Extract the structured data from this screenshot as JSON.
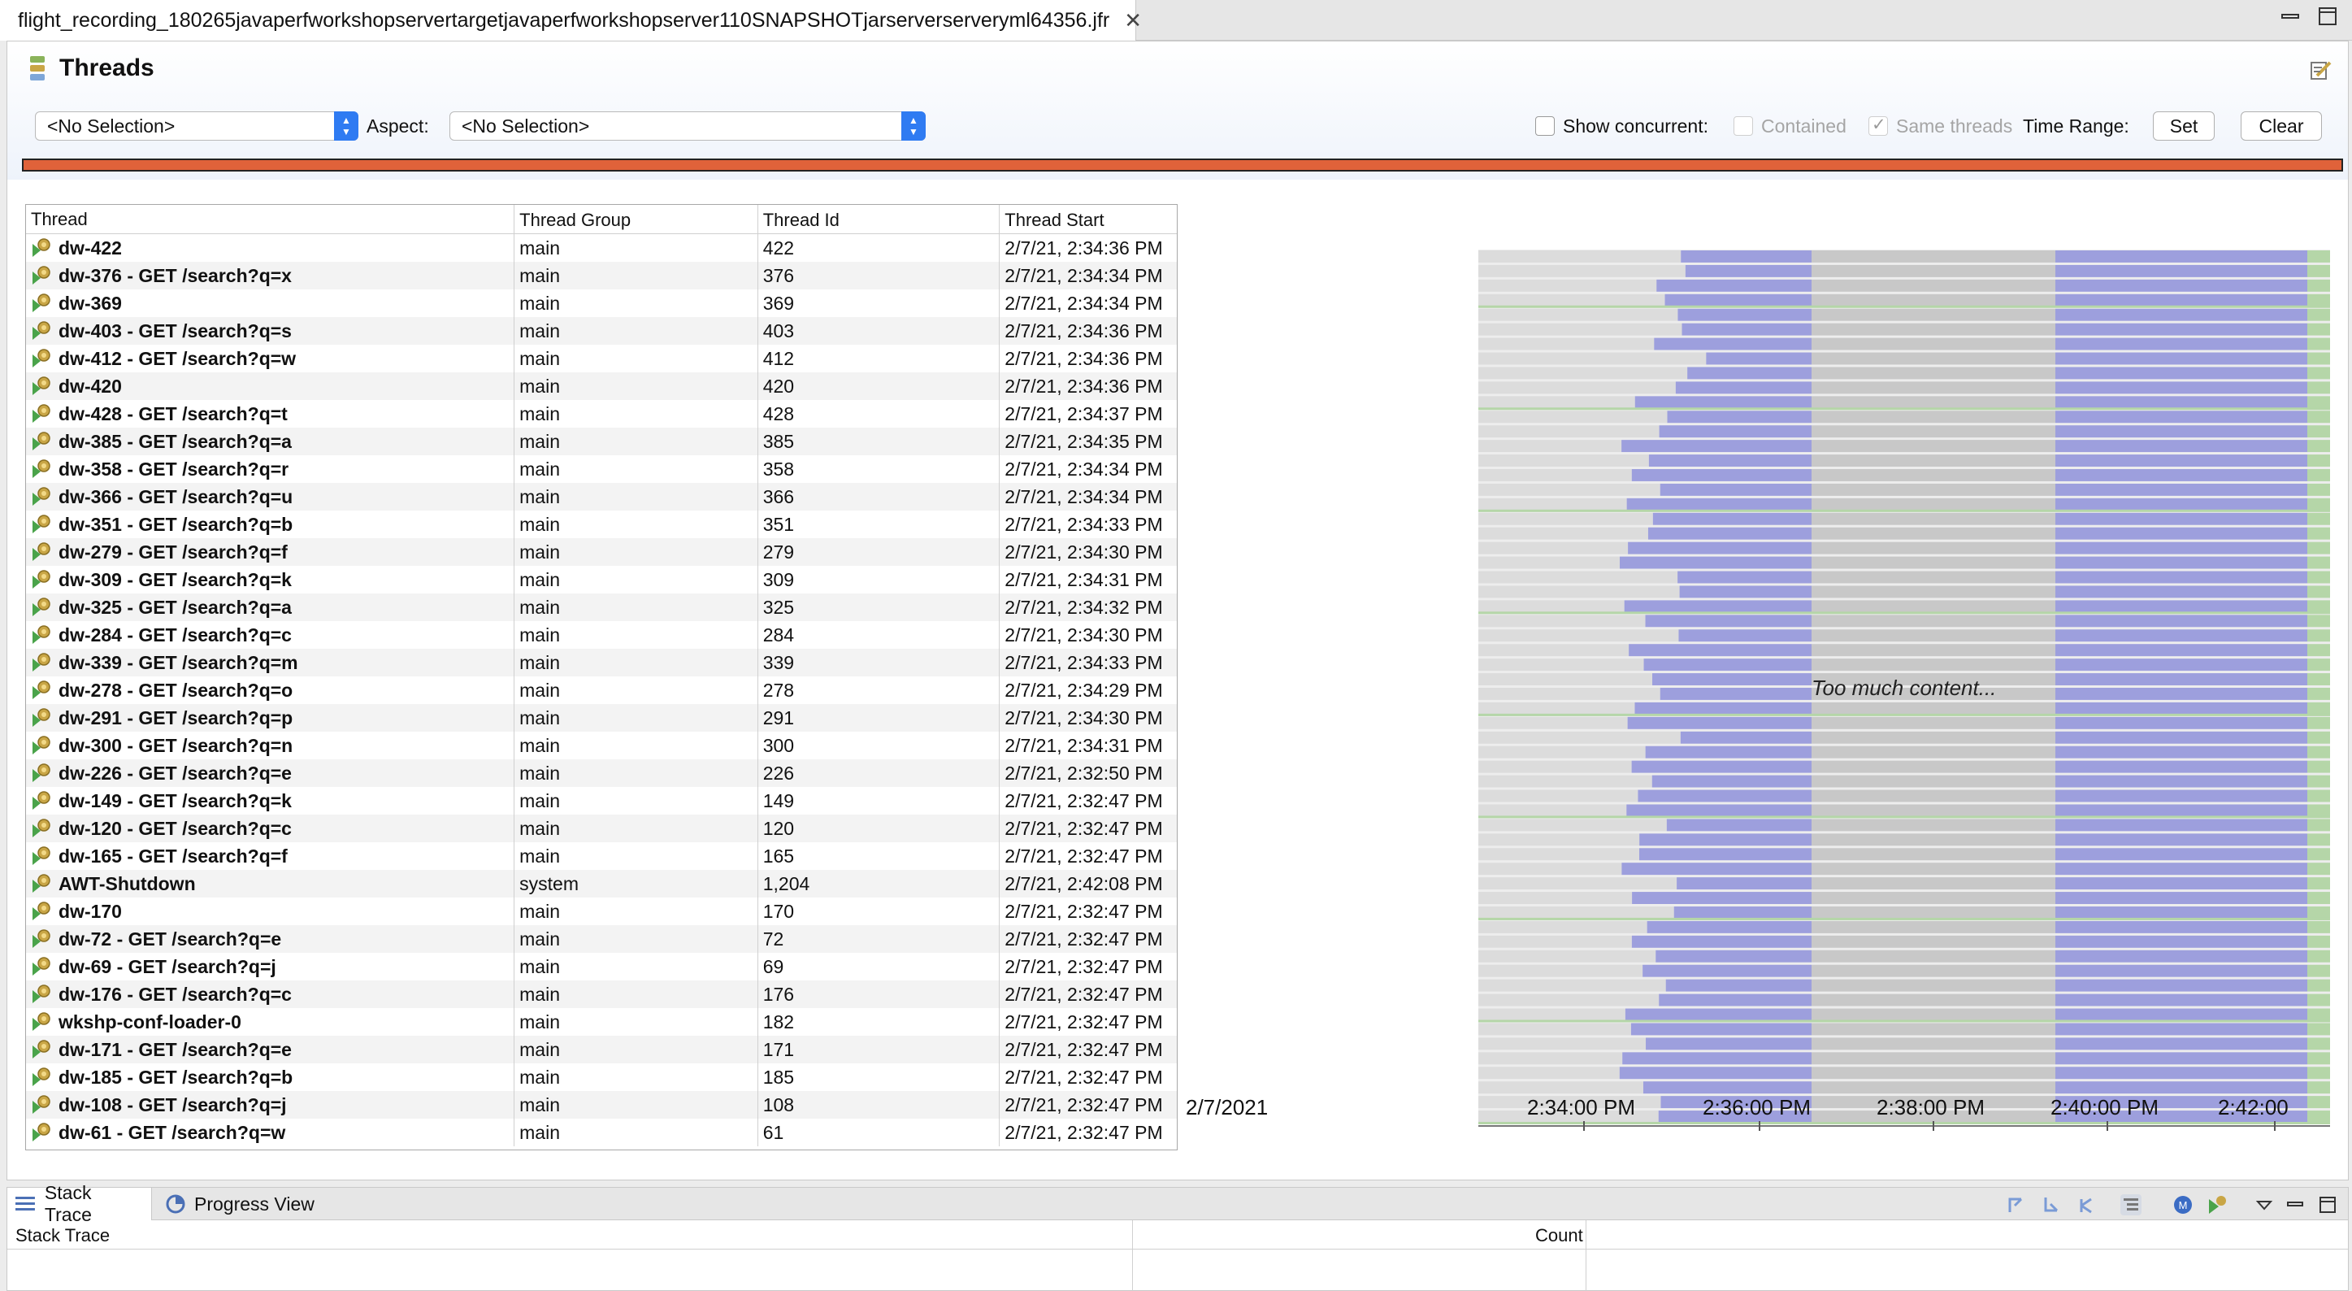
{
  "editor_tab": {
    "title": "flight_recording_180265javaperfworkshopservertargetjavaperfworkshopserver110SNAPSHOTjarserverserveryml64356.jfr",
    "close": "✕"
  },
  "page": {
    "title": "Threads"
  },
  "toolbar": {
    "selection_value": "<No Selection>",
    "aspect_label": "Aspect:",
    "aspect_value": "<No Selection>",
    "show_concurrent_label": "Show concurrent:",
    "contained_label": "Contained",
    "same_threads_label": "Same threads",
    "time_range_label": "Time Range:",
    "set_label": "Set",
    "clear_label": "Clear"
  },
  "table": {
    "columns": [
      "Thread",
      "Thread Group",
      "Thread Id",
      "Thread Start"
    ],
    "rows": [
      {
        "thread": "dw-422",
        "group": "main",
        "id": "422",
        "start": "2/7/21, 2:34:36 PM"
      },
      {
        "thread": "dw-376 - GET /search?q=x",
        "group": "main",
        "id": "376",
        "start": "2/7/21, 2:34:34 PM"
      },
      {
        "thread": "dw-369",
        "group": "main",
        "id": "369",
        "start": "2/7/21, 2:34:34 PM"
      },
      {
        "thread": "dw-403 - GET /search?q=s",
        "group": "main",
        "id": "403",
        "start": "2/7/21, 2:34:36 PM"
      },
      {
        "thread": "dw-412 - GET /search?q=w",
        "group": "main",
        "id": "412",
        "start": "2/7/21, 2:34:36 PM"
      },
      {
        "thread": "dw-420",
        "group": "main",
        "id": "420",
        "start": "2/7/21, 2:34:36 PM"
      },
      {
        "thread": "dw-428 - GET /search?q=t",
        "group": "main",
        "id": "428",
        "start": "2/7/21, 2:34:37 PM"
      },
      {
        "thread": "dw-385 - GET /search?q=a",
        "group": "main",
        "id": "385",
        "start": "2/7/21, 2:34:35 PM"
      },
      {
        "thread": "dw-358 - GET /search?q=r",
        "group": "main",
        "id": "358",
        "start": "2/7/21, 2:34:34 PM"
      },
      {
        "thread": "dw-366 - GET /search?q=u",
        "group": "main",
        "id": "366",
        "start": "2/7/21, 2:34:34 PM"
      },
      {
        "thread": "dw-351 - GET /search?q=b",
        "group": "main",
        "id": "351",
        "start": "2/7/21, 2:34:33 PM"
      },
      {
        "thread": "dw-279 - GET /search?q=f",
        "group": "main",
        "id": "279",
        "start": "2/7/21, 2:34:30 PM"
      },
      {
        "thread": "dw-309 - GET /search?q=k",
        "group": "main",
        "id": "309",
        "start": "2/7/21, 2:34:31 PM"
      },
      {
        "thread": "dw-325 - GET /search?q=a",
        "group": "main",
        "id": "325",
        "start": "2/7/21, 2:34:32 PM"
      },
      {
        "thread": "dw-284 - GET /search?q=c",
        "group": "main",
        "id": "284",
        "start": "2/7/21, 2:34:30 PM"
      },
      {
        "thread": "dw-339 - GET /search?q=m",
        "group": "main",
        "id": "339",
        "start": "2/7/21, 2:34:33 PM"
      },
      {
        "thread": "dw-278 - GET /search?q=o",
        "group": "main",
        "id": "278",
        "start": "2/7/21, 2:34:29 PM"
      },
      {
        "thread": "dw-291 - GET /search?q=p",
        "group": "main",
        "id": "291",
        "start": "2/7/21, 2:34:30 PM"
      },
      {
        "thread": "dw-300 - GET /search?q=n",
        "group": "main",
        "id": "300",
        "start": "2/7/21, 2:34:31 PM"
      },
      {
        "thread": "dw-226 - GET /search?q=e",
        "group": "main",
        "id": "226",
        "start": "2/7/21, 2:32:50 PM"
      },
      {
        "thread": "dw-149 - GET /search?q=k",
        "group": "main",
        "id": "149",
        "start": "2/7/21, 2:32:47 PM"
      },
      {
        "thread": "dw-120 - GET /search?q=c",
        "group": "main",
        "id": "120",
        "start": "2/7/21, 2:32:47 PM"
      },
      {
        "thread": "dw-165 - GET /search?q=f",
        "group": "main",
        "id": "165",
        "start": "2/7/21, 2:32:47 PM"
      },
      {
        "thread": "AWT-Shutdown",
        "group": "system",
        "id": "1,204",
        "start": "2/7/21, 2:42:08 PM"
      },
      {
        "thread": "dw-170",
        "group": "main",
        "id": "170",
        "start": "2/7/21, 2:32:47 PM"
      },
      {
        "thread": "dw-72 - GET /search?q=e",
        "group": "main",
        "id": "72",
        "start": "2/7/21, 2:32:47 PM"
      },
      {
        "thread": "dw-69 - GET /search?q=j",
        "group": "main",
        "id": "69",
        "start": "2/7/21, 2:32:47 PM"
      },
      {
        "thread": "dw-176 - GET /search?q=c",
        "group": "main",
        "id": "176",
        "start": "2/7/21, 2:32:47 PM"
      },
      {
        "thread": "wkshp-conf-loader-0",
        "group": "main",
        "id": "182",
        "start": "2/7/21, 2:32:47 PM"
      },
      {
        "thread": "dw-171 - GET /search?q=e",
        "group": "main",
        "id": "171",
        "start": "2/7/21, 2:32:47 PM"
      },
      {
        "thread": "dw-185 - GET /search?q=b",
        "group": "main",
        "id": "185",
        "start": "2/7/21, 2:32:47 PM"
      },
      {
        "thread": "dw-108 - GET /search?q=j",
        "group": "main",
        "id": "108",
        "start": "2/7/21, 2:32:47 PM"
      },
      {
        "thread": "dw-61 - GET /search?q=w",
        "group": "main",
        "id": "61",
        "start": "2/7/21, 2:32:47 PM"
      }
    ]
  },
  "chart": {
    "date_label": "2/7/2021",
    "overlay_text": "Too much content...",
    "ticks": [
      "2:34:00 PM",
      "2:36:00 PM",
      "2:38:00 PM",
      "2:40:00 PM",
      "2:42:00"
    ],
    "colors": {
      "running": "#9d9fdd",
      "idle": "#c8c8c8",
      "green": "#b5d6a8"
    }
  },
  "bottom": {
    "tabs": [
      "Stack Trace",
      "Progress View"
    ],
    "stack_trace_col": "Stack Trace",
    "count_col": "Count"
  }
}
